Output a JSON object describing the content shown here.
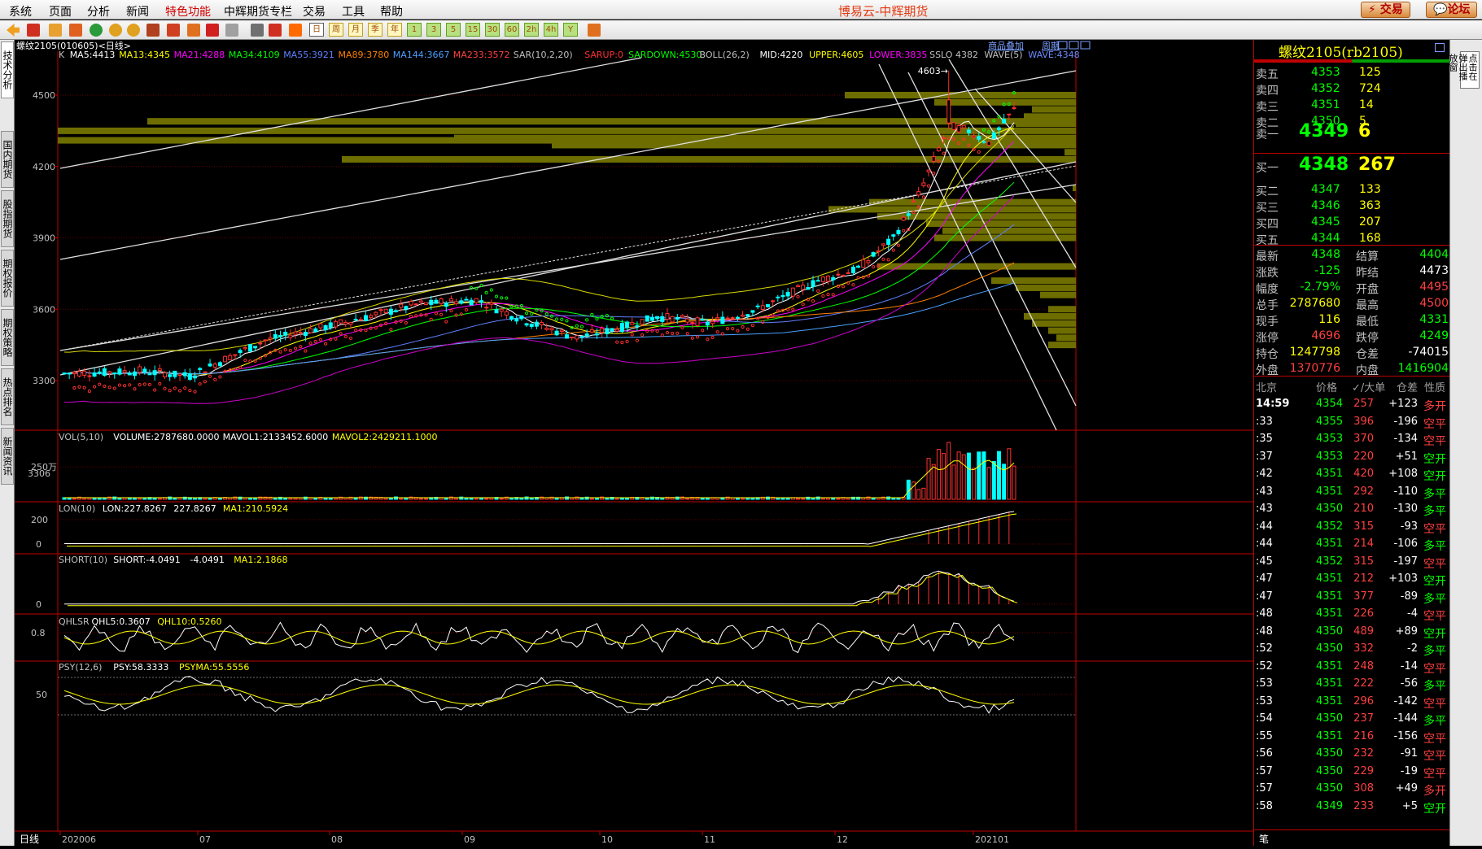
{
  "menu": [
    "系统",
    "页面",
    "分析",
    "新闻",
    "特色功能",
    "中辉期货专栏",
    "交易",
    "工具",
    "帮助"
  ],
  "app_title": "博易云-中辉期货",
  "top_buttons": {
    "trade": "交易",
    "forum": "论坛"
  },
  "toolbar_text": [
    "日",
    "周",
    "月",
    "季",
    "年",
    "1",
    "3",
    "5",
    "15",
    "30",
    "60",
    "2h",
    "4h",
    "Y"
  ],
  "left_tabs": [
    "技术分析",
    "国内期货",
    "股指期货",
    "期权报价",
    "期权策略",
    "热点排名",
    "新闻资讯"
  ],
  "chart": {
    "symbol_line": "螺纹2105(010605)<日线>",
    "links": {
      "goods": "商品叠加",
      "period": "周期"
    },
    "ind_main": [
      {
        "t": "K",
        "c": "#c0c0c0"
      },
      {
        "t": "MA5:4413",
        "c": "#ffffff"
      },
      {
        "t": "MA13:4345",
        "c": "#ffff00"
      },
      {
        "t": "MA21:4288",
        "c": "#ff00ff"
      },
      {
        "t": "MA34:4109",
        "c": "#00ff00"
      },
      {
        "t": "MA55:3921",
        "c": "#6080ff"
      },
      {
        "t": "MA89:3780",
        "c": "#ff8000"
      },
      {
        "t": "MA144:3667",
        "c": "#4aa0ff"
      },
      {
        "t": "MA233:3572",
        "c": "#ff4040"
      },
      {
        "t": "SAR(10,2,20)",
        "c": "#c0c0c0"
      },
      {
        "t": "SARUP:0",
        "c": "#ff3030"
      },
      {
        "t": "SARDOWN:4530",
        "c": "#00ff00"
      },
      {
        "t": "BOLL(26,2)",
        "c": "#c0c0c0"
      },
      {
        "t": "MID:4220",
        "c": "#ffffff"
      },
      {
        "t": "UPPER:4605",
        "c": "#ffff00"
      },
      {
        "t": "LOWER:3835",
        "c": "#ff00ff"
      },
      {
        "t": "SSLO 4382",
        "c": "#c0c0c0"
      },
      {
        "t": "WAVE(5)",
        "c": "#c0c0c0"
      },
      {
        "t": "WAVE:4348",
        "c": "#6a8aff"
      }
    ],
    "price_ticks": [
      "4500",
      "4200",
      "3900",
      "3600",
      "3300"
    ],
    "annot_high": "4603",
    "annot_low": "3306",
    "vol_line": [
      {
        "t": "VOL(5,10)",
        "c": "#c0c0c0"
      },
      {
        "t": "VOLUME:2787680.0000",
        "c": "#ffffff"
      },
      {
        "t": "MAVOL1:2133452.6000",
        "c": "#ffffff"
      },
      {
        "t": "MAVOL2:2429211.1000",
        "c": "#ffff00"
      }
    ],
    "vol_tick": "250万",
    "lon_line": [
      {
        "t": "LON(10)",
        "c": "#c0c0c0"
      },
      {
        "t": "LON:227.8267",
        "c": "#ffffff"
      },
      {
        "t": "227.8267",
        "c": "#ffffff"
      },
      {
        "t": "MA1:210.5924",
        "c": "#ffff00"
      }
    ],
    "lon_ticks": [
      "200",
      "0"
    ],
    "short_line": [
      {
        "t": "SHORT(10)",
        "c": "#c0c0c0"
      },
      {
        "t": "SHORT:-4.0491",
        "c": "#ffffff"
      },
      {
        "t": "-4.0491",
        "c": "#ffffff"
      },
      {
        "t": "MA1:2.1868",
        "c": "#ffff00"
      }
    ],
    "short_tick": "0",
    "qhl_line": [
      {
        "t": "QHLSR",
        "c": "#c0c0c0"
      },
      {
        "t": "QHL5:0.3607",
        "c": "#ffffff"
      },
      {
        "t": "QHL10:0.5260",
        "c": "#ffff00"
      }
    ],
    "qhl_tick": "0.8",
    "psy_line": [
      {
        "t": "PSY(12,6)",
        "c": "#c0c0c0"
      },
      {
        "t": "PSY:58.3333",
        "c": "#ffffff"
      },
      {
        "t": "PSYMA:55.5556",
        "c": "#ffff00"
      }
    ],
    "psy_tick": "50",
    "period_label": "日线",
    "date_labels": [
      "202006",
      "07",
      "08",
      "09",
      "10",
      "11",
      "12",
      "202101"
    ]
  },
  "quote": {
    "title": "螺纹2105(rb2105)",
    "asks": [
      {
        "l": "卖五",
        "p": "4353",
        "v": "125"
      },
      {
        "l": "卖四",
        "p": "4352",
        "v": "724"
      },
      {
        "l": "卖三",
        "p": "4351",
        "v": "14"
      },
      {
        "l": "卖二",
        "p": "4350",
        "v": "5"
      },
      {
        "l": "卖一",
        "p": "4349",
        "v": "6"
      }
    ],
    "bids": [
      {
        "l": "买一",
        "p": "4348",
        "v": "267"
      },
      {
        "l": "买二",
        "p": "4347",
        "v": "133"
      },
      {
        "l": "买三",
        "p": "4346",
        "v": "363"
      },
      {
        "l": "买四",
        "p": "4345",
        "v": "207"
      },
      {
        "l": "买五",
        "p": "4344",
        "v": "168"
      }
    ],
    "stats": [
      {
        "l1": "最新",
        "v1": "4348",
        "c1": "#00ff00",
        "l2": "结算",
        "v2": "4404",
        "c2": "#00ff00"
      },
      {
        "l1": "涨跌",
        "v1": "-125",
        "c1": "#00ff00",
        "l2": "昨结",
        "v2": "4473",
        "c2": "#ffffff"
      },
      {
        "l1": "幅度",
        "v1": "-2.79%",
        "c1": "#00ff00",
        "l2": "开盘",
        "v2": "4495",
        "c2": "#ff4040"
      },
      {
        "l1": "总手",
        "v1": "2787680",
        "c1": "#ffff00",
        "l2": "最高",
        "v2": "4500",
        "c2": "#ff4040"
      },
      {
        "l1": "现手",
        "v1": "116",
        "c1": "#ffff00",
        "l2": "最低",
        "v2": "4331",
        "c2": "#00ff00"
      },
      {
        "l1": "涨停",
        "v1": "4696",
        "c1": "#ff4040",
        "l2": "跌停",
        "v2": "4249",
        "c2": "#00ff00"
      },
      {
        "l1": "持仓",
        "v1": "1247798",
        "c1": "#ffff00",
        "l2": "仓差",
        "v2": "-74015",
        "c2": "#ffffff"
      },
      {
        "l1": "外盘",
        "v1": "1370776",
        "c1": "#ff4040",
        "l2": "内盘",
        "v2": "1416904",
        "c2": "#00ff00"
      }
    ],
    "tick_header": [
      "北京",
      "价格",
      "✓/大单",
      "仓差",
      "性质"
    ],
    "ticks": [
      {
        "t": "14:59",
        "p": "4354",
        "v": "257",
        "d": "+123",
        "n": "多开"
      },
      {
        "t": ":33",
        "p": "4355",
        "v": "396",
        "d": "-196",
        "n": "空平"
      },
      {
        "t": ":35",
        "p": "4353",
        "v": "370",
        "d": "-134",
        "n": "空平"
      },
      {
        "t": ":37",
        "p": "4353",
        "v": "220",
        "d": "+51",
        "n": "空开"
      },
      {
        "t": ":42",
        "p": "4351",
        "v": "420",
        "d": "+108",
        "n": "空开"
      },
      {
        "t": ":43",
        "p": "4351",
        "v": "292",
        "d": "-110",
        "n": "多平"
      },
      {
        "t": ":43",
        "p": "4350",
        "v": "210",
        "d": "-130",
        "n": "多平"
      },
      {
        "t": ":44",
        "p": "4352",
        "v": "315",
        "d": "-93",
        "n": "空平"
      },
      {
        "t": ":44",
        "p": "4351",
        "v": "214",
        "d": "-106",
        "n": "多平"
      },
      {
        "t": ":45",
        "p": "4352",
        "v": "315",
        "d": "-197",
        "n": "空平"
      },
      {
        "t": ":47",
        "p": "4351",
        "v": "212",
        "d": "+103",
        "n": "空开"
      },
      {
        "t": ":47",
        "p": "4351",
        "v": "377",
        "d": "-89",
        "n": "多平"
      },
      {
        "t": ":48",
        "p": "4351",
        "v": "226",
        "d": "-4",
        "n": "空平"
      },
      {
        "t": ":48",
        "p": "4350",
        "v": "489",
        "d": "+89",
        "n": "空开"
      },
      {
        "t": ":52",
        "p": "4350",
        "v": "332",
        "d": "-2",
        "n": "多平"
      },
      {
        "t": ":52",
        "p": "4351",
        "v": "248",
        "d": "-14",
        "n": "空平"
      },
      {
        "t": ":53",
        "p": "4351",
        "v": "222",
        "d": "-56",
        "n": "多平"
      },
      {
        "t": ":53",
        "p": "4351",
        "v": "296",
        "d": "-142",
        "n": "空平"
      },
      {
        "t": ":54",
        "p": "4350",
        "v": "237",
        "d": "-144",
        "n": "多平"
      },
      {
        "t": ":55",
        "p": "4351",
        "v": "216",
        "d": "-156",
        "n": "空平"
      },
      {
        "t": ":56",
        "p": "4350",
        "v": "232",
        "d": "-91",
        "n": "空平"
      },
      {
        "t": ":57",
        "p": "4350",
        "v": "229",
        "d": "-19",
        "n": "空平"
      },
      {
        "t": ":57",
        "p": "4350",
        "v": "308",
        "d": "+49",
        "n": "多开"
      },
      {
        "t": ":58",
        "p": "4349",
        "v": "233",
        "d": "+5",
        "n": "空开"
      }
    ],
    "bottom_label": "笔"
  },
  "farright_text": "点击在弹出播放窗"
}
